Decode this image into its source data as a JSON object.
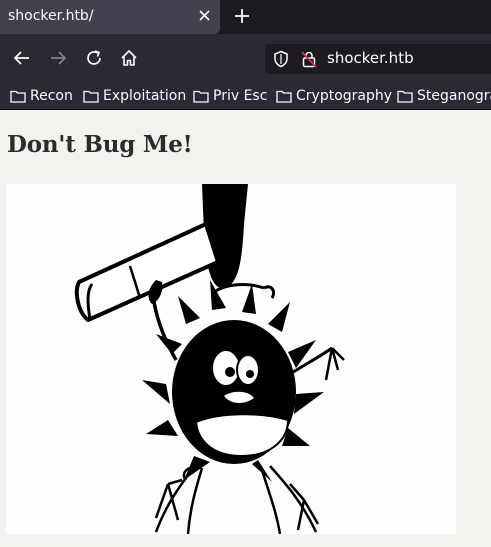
{
  "browser": {
    "tab_title": "shocker.htb/",
    "url": "shocker.htb",
    "icons": {
      "close": "close-icon",
      "new_tab": "plus-icon",
      "back": "arrow-left-icon",
      "forward": "arrow-right-icon",
      "reload": "reload-icon",
      "home": "home-icon",
      "tracking": "shield-icon",
      "connection": "insecure-lock-icon",
      "folder": "folder-icon"
    },
    "bookmarks": [
      {
        "label": "Recon"
      },
      {
        "label": "Exploitation"
      },
      {
        "label": "Priv Esc"
      },
      {
        "label": "Cryptography"
      },
      {
        "label": "Steganogra"
      }
    ]
  },
  "page": {
    "heading": "Don't Bug Me!",
    "image_subject": "cartoon bug being hit by hammer"
  },
  "colors": {
    "tabbar_bg": "#1c1b22",
    "toolbar_bg": "#2b2a33",
    "page_bg": "#f4f2ef",
    "text_light": "#fbfbfe"
  }
}
